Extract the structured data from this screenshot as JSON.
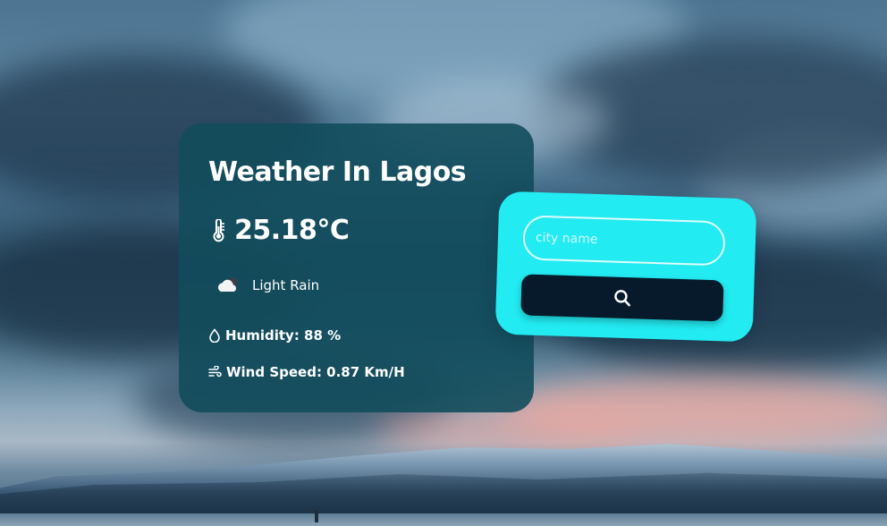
{
  "weather": {
    "title": "Weather In Lagos",
    "temperature": "25.18°C",
    "condition": "Light Rain",
    "humidity": "Humidity: 88 %",
    "wind_speed": "Wind Speed: 0.87 Km/H"
  },
  "search": {
    "placeholder": "city name",
    "value": ""
  },
  "icons": {
    "temperature": "thermometer-icon",
    "condition": "cloud-rain-icon",
    "humidity": "droplet-icon",
    "wind": "wind-icon",
    "search": "search-icon"
  },
  "colors": {
    "weather_card": "#124c5c",
    "search_card": "#22ebf2",
    "search_button": "#071a2b",
    "text": "#ffffff"
  }
}
